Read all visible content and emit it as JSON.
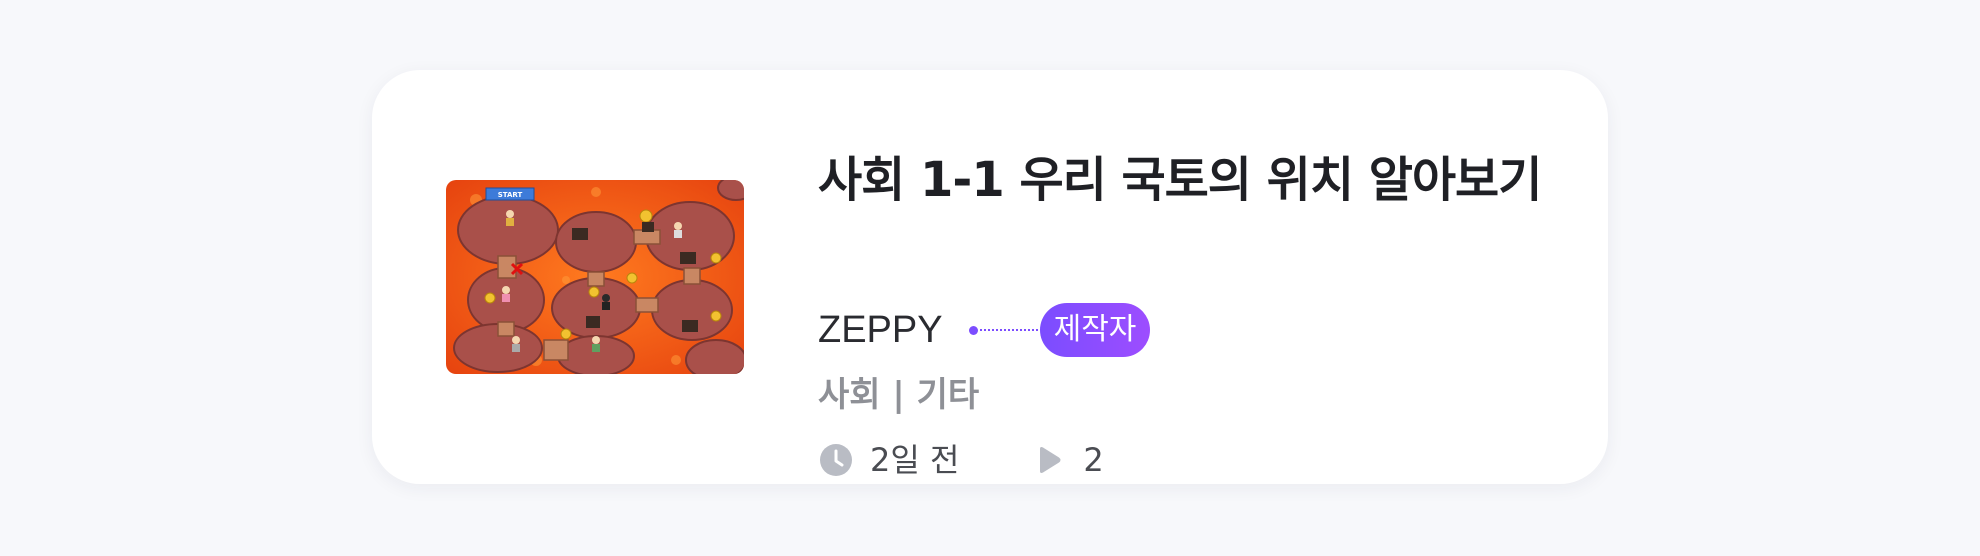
{
  "card": {
    "title": "사회 1-1 우리 국토의 위치 알아보기",
    "creator": "ZEPPY",
    "creator_badge": "제작자",
    "category": "사회 | 기타",
    "time_ago": "2일 전",
    "play_count": "2",
    "thumbnail": {
      "start_sign": "START",
      "description_icon": "game-map-thumbnail"
    }
  },
  "colors": {
    "badge_start": "#7b4dff",
    "badge_end": "#9d4dff",
    "title": "#1f2025",
    "muted": "#8e9096",
    "icon": "#b9bcc4",
    "lava": "#f4561c",
    "rock": "#a9504a"
  },
  "icons": {
    "time": "clock-icon",
    "plays": "play-icon"
  }
}
